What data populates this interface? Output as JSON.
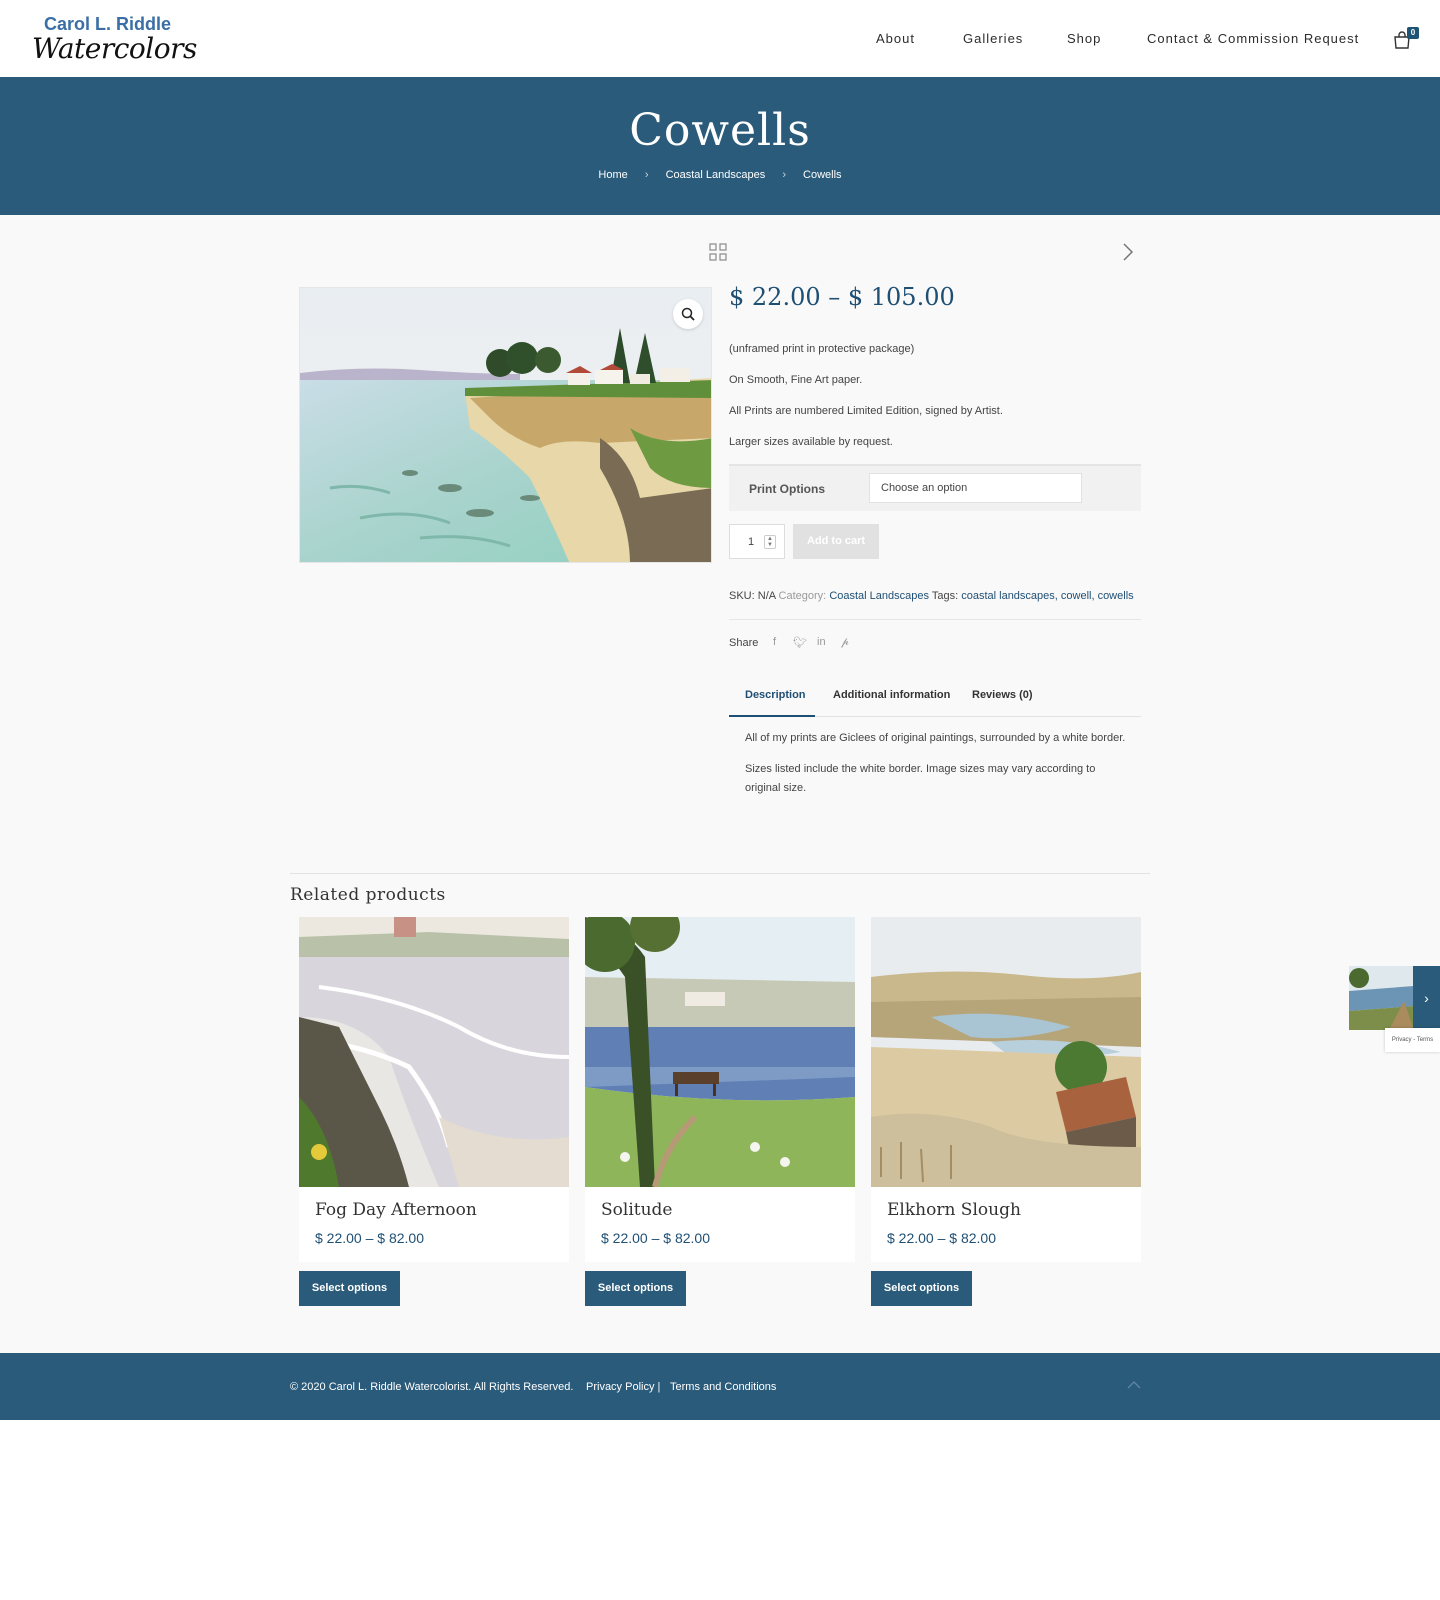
{
  "logo": {
    "line1": "Carol L. Riddle",
    "line2": "Watercolors"
  },
  "nav": {
    "items": [
      "About",
      "Galleries",
      "Shop",
      "Contact & Commission Request"
    ]
  },
  "cart": {
    "count": "0"
  },
  "hero": {
    "title": "Cowells",
    "breadcrumb": [
      "Home",
      "Coastal Landscapes",
      "Cowells"
    ]
  },
  "product": {
    "price_range": "$ 22.00 – $ 105.00",
    "short_description": [
      "(unframed print in protective package)",
      "On Smooth, Fine Art paper.",
      "All Prints are numbered Limited Edition, signed by Artist.",
      "Larger sizes available by request."
    ],
    "variation_label": "Print Options",
    "variation_placeholder": "Choose an option",
    "quantity": "1",
    "add_to_cart": "Add to cart",
    "sku_label": "SKU:",
    "sku_value": "N/A",
    "category_label": "Category:",
    "category": "Coastal Landscapes",
    "tags_label": "Tags:",
    "tags": "coastal landscapes, cowell, cowells",
    "share_label": "Share",
    "share_icons": [
      "facebook-icon",
      "twitter-icon",
      "linkedin-icon",
      "pinterest-icon"
    ]
  },
  "tabs": {
    "items": [
      "Description",
      "Additional information",
      "Reviews (0)"
    ],
    "active": "Description",
    "description": [
      "All of my prints are Giclees of original paintings, surrounded by a white border.",
      "Sizes listed include the white border.  Image sizes may vary according to",
      "original size."
    ]
  },
  "related": {
    "title": "Related products",
    "items": [
      {
        "title": "Fog Day Afternoon",
        "price": "$ 22.00 – $ 82.00",
        "button": "Select options"
      },
      {
        "title": "Solitude",
        "price": "$ 22.00 – $ 82.00",
        "button": "Select options"
      },
      {
        "title": "Elkhorn Slough",
        "price": "$ 22.00 – $ 82.00",
        "button": "Select options"
      }
    ]
  },
  "recaptcha": {
    "text": "Privacy - Terms"
  },
  "footer": {
    "copyright": "© 2020 Carol L. Riddle Watercolorist. All Rights Reserved.",
    "privacy": "Privacy Policy |",
    "terms": "Terms and Conditions"
  },
  "colors": {
    "brand": "#2a5b7a",
    "price": "#1f4f73",
    "background": "#f9f9f9"
  }
}
